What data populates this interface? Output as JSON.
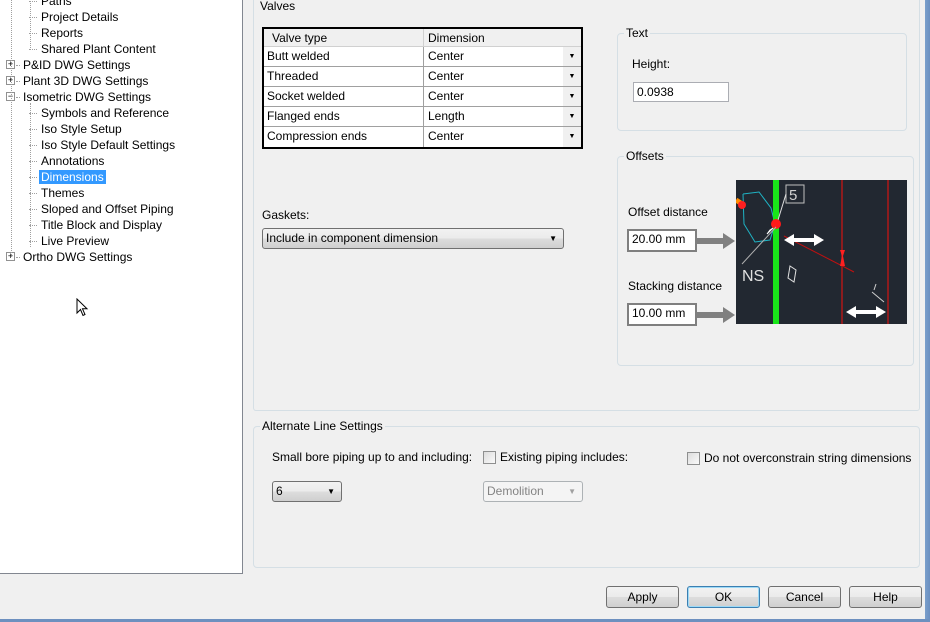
{
  "tree": {
    "items": [
      {
        "label": "Paths",
        "level": 1
      },
      {
        "label": "Project Details",
        "level": 1
      },
      {
        "label": "Reports",
        "level": 1
      },
      {
        "label": "Shared Plant Content",
        "level": 1
      },
      {
        "label": "P&ID DWG Settings",
        "level": 0,
        "expander": "+"
      },
      {
        "label": "Plant 3D DWG Settings",
        "level": 0,
        "expander": "+"
      },
      {
        "label": "Isometric DWG Settings",
        "level": 0,
        "expander": "−"
      },
      {
        "label": "Symbols and Reference",
        "level": 1
      },
      {
        "label": "Iso Style Setup",
        "level": 1
      },
      {
        "label": "Iso Style Default Settings",
        "level": 1
      },
      {
        "label": "Annotations",
        "level": 1
      },
      {
        "label": "Dimensions",
        "level": 1,
        "selected": true
      },
      {
        "label": "Themes",
        "level": 1
      },
      {
        "label": "Sloped and Offset Piping",
        "level": 1
      },
      {
        "label": "Title Block and Display",
        "level": 1
      },
      {
        "label": "Live Preview",
        "level": 1
      },
      {
        "label": "Ortho DWG Settings",
        "level": 0,
        "expander": "+"
      }
    ]
  },
  "valves": {
    "title": "Valves",
    "columns": [
      "Valve type",
      "Dimension"
    ],
    "rows": [
      {
        "type": "Butt welded",
        "dimension": "Center"
      },
      {
        "type": "Threaded",
        "dimension": "Center"
      },
      {
        "type": "Socket welded",
        "dimension": "Center"
      },
      {
        "type": "Flanged ends",
        "dimension": "Length"
      },
      {
        "type": "Compression ends",
        "dimension": "Center"
      }
    ]
  },
  "gaskets": {
    "label": "Gaskets:",
    "value": "Include in component dimension"
  },
  "text_group": {
    "title": "Text",
    "height_label": "Height:",
    "height_value": "0.0938"
  },
  "offsets": {
    "title": "Offsets",
    "offset_label": "Offset distance",
    "offset_value": "20.00 mm",
    "stacking_label": "Stacking distance",
    "stacking_value": "10.00 mm",
    "preview_labels": {
      "tag": "5",
      "ns": "NS"
    },
    "colors": {
      "background": "#222831",
      "pipe": "#00ff00",
      "dimension": "#ff0000"
    }
  },
  "alternate": {
    "title": "Alternate Line Settings",
    "small_bore_label": "Small bore piping up to and including:",
    "small_bore_value": "6",
    "existing_label": "Existing piping includes:",
    "existing_checked": false,
    "existing_value": "Demolition",
    "overconstrain_label": "Do not overconstrain string dimensions",
    "overconstrain_checked": false
  },
  "buttons": {
    "apply": "Apply",
    "ok": "OK",
    "cancel": "Cancel",
    "help": "Help"
  },
  "selection_color": "#3399ff"
}
